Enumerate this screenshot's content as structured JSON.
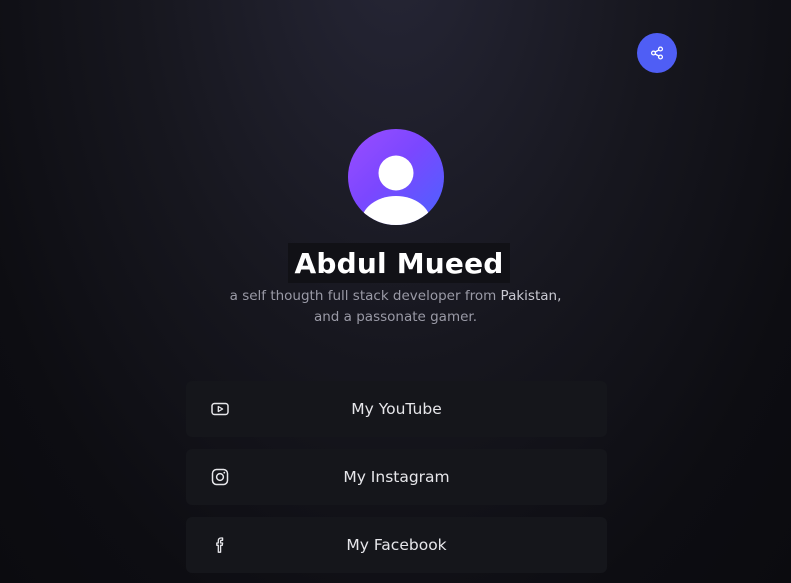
{
  "profile": {
    "name": "Abdul Mueed",
    "bio_prefix": "a self thougth full stack developer from",
    "bio_country": "Pakistan,",
    "bio_line2": "and a passonate gamer."
  },
  "share": {
    "icon": "share-icon",
    "accent": "#4f5ef5"
  },
  "links": [
    {
      "label": "My YouTube",
      "icon": "youtube-icon"
    },
    {
      "label": "My Instagram",
      "icon": "instagram-icon"
    },
    {
      "label": "My Facebook",
      "icon": "facebook-icon"
    }
  ],
  "colors": {
    "background": "#0d0d12",
    "button_bg": "#15161b",
    "avatar_gradient_start": "#9a4dff",
    "avatar_gradient_end": "#4a63ff"
  }
}
